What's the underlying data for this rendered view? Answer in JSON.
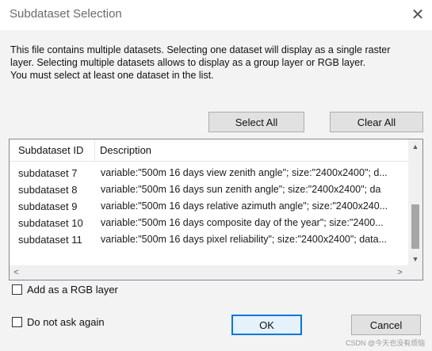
{
  "window": {
    "title": "Subdataset Selection",
    "close_glyph": "✕"
  },
  "message": {
    "line1": "This file contains multiple datasets. Selecting one dataset will display as a single raster",
    "line2": "layer. Selecting multiple datasets allows to display as a group layer or RGB layer.",
    "line3": "You must select at least one dataset in the list."
  },
  "buttons": {
    "select_all": "Select All",
    "clear_all": "Clear All",
    "ok": "OK",
    "cancel": "Cancel"
  },
  "list": {
    "columns": [
      "Subdataset ID",
      "Description"
    ],
    "rows": [
      {
        "id": "subdataset 7",
        "description": "variable:\"500m 16 days view zenith angle\"; size:\"2400x2400\"; d..."
      },
      {
        "id": "subdataset 8",
        "description": "variable:\"500m 16 days sun zenith angle\"; size:\"2400x2400\"; da"
      },
      {
        "id": "subdataset 9",
        "description": "variable:\"500m 16 days relative azimuth angle\"; size:\"2400x240..."
      },
      {
        "id": "subdataset 10",
        "description": "variable:\"500m 16 days composite day of the year\"; size:\"2400..."
      },
      {
        "id": "subdataset 11",
        "description": "variable:\"500m 16 days pixel reliability\"; size:\"2400x2400\"; data..."
      }
    ],
    "scroll": {
      "up_glyph": "▲",
      "down_glyph": "▼",
      "left_glyph": "<",
      "right_glyph": ">"
    }
  },
  "options": {
    "rgb_layer": {
      "label": "Add as a RGB layer",
      "checked": false
    },
    "do_not_ask": {
      "label": "Do not ask again",
      "checked": false
    }
  },
  "watermark": "CSDN @今天也没有烦恼",
  "colors": {
    "default_button_border": "#0078d7",
    "dialog_background": "#f3f3f3"
  }
}
